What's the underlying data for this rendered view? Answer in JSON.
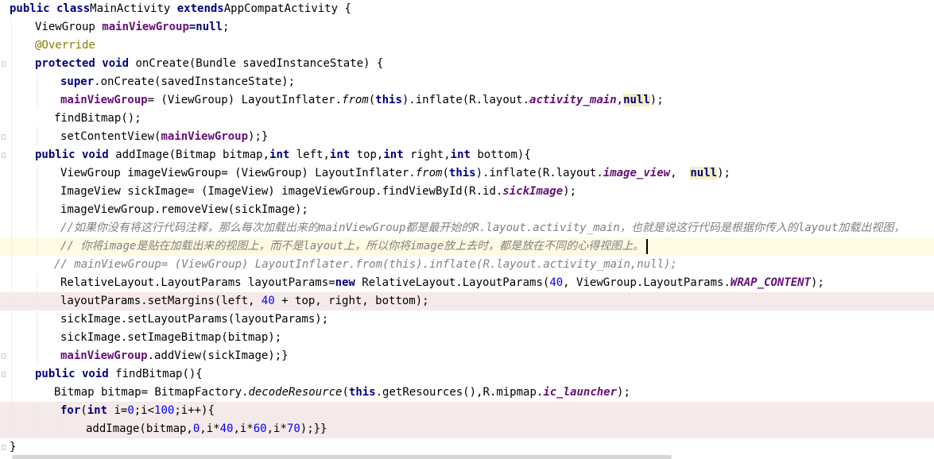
{
  "editor": {
    "language": "Java",
    "lines": [
      {
        "indent": 0,
        "hl": "",
        "tokens": [
          [
            "kw",
            "public class"
          ],
          [
            "",
            "MainActivity "
          ],
          [
            "kw",
            "extends"
          ],
          [
            "",
            "AppCompatActivity {"
          ]
        ]
      },
      {
        "indent": 1,
        "hl": "",
        "tokens": [
          [
            "",
            "ViewGroup "
          ],
          [
            "fld",
            "mainViewGroup"
          ],
          [
            "kw",
            "=null"
          ],
          [
            "",
            ";"
          ]
        ]
      },
      {
        "indent": 1,
        "hl": "",
        "tokens": [
          [
            "ann",
            "@Override"
          ]
        ]
      },
      {
        "indent": 1,
        "hl": "",
        "tokens": [
          [
            "kw",
            "protected void "
          ],
          [
            "",
            "onCreate(Bundle savedInstanceState) {"
          ]
        ]
      },
      {
        "indent": 2,
        "hl": "",
        "tokens": [
          [
            "kw",
            "super"
          ],
          [
            "",
            ".onCreate(savedInstanceState);"
          ]
        ]
      },
      {
        "indent": 2,
        "hl": "",
        "tokens": [
          [
            "fld",
            "mainViewGroup"
          ],
          [
            "",
            "= (ViewGroup) LayoutInflater."
          ],
          [
            "st",
            "from"
          ],
          [
            "",
            "("
          ],
          [
            "kw",
            "this"
          ],
          [
            "",
            ").inflate(R.layout."
          ],
          [
            "fldi",
            "activity_main"
          ],
          [
            "",
            ","
          ],
          [
            "kw nullbox",
            "null"
          ],
          [
            "",
            ");"
          ]
        ]
      },
      {
        "indent": 1.75,
        "hl": "",
        "tokens": [
          [
            "",
            "findBitmap();"
          ]
        ]
      },
      {
        "indent": 2,
        "hl": "",
        "tokens": [
          [
            "",
            "setContentView("
          ],
          [
            "fld",
            "mainViewGroup"
          ],
          [
            "",
            ");}"
          ]
        ]
      },
      {
        "indent": 1,
        "hl": "",
        "tokens": [
          [
            "kw",
            "public void "
          ],
          [
            "",
            "addImage(Bitmap bitmap,"
          ],
          [
            "kw",
            "int "
          ],
          [
            "",
            "left,"
          ],
          [
            "kw",
            "int "
          ],
          [
            "",
            "top,"
          ],
          [
            "kw",
            "int "
          ],
          [
            "",
            "right,"
          ],
          [
            "kw",
            "int "
          ],
          [
            "",
            "bottom){"
          ]
        ]
      },
      {
        "indent": 2,
        "hl": "",
        "tokens": [
          [
            "",
            "ViewGroup imageViewGroup= (ViewGroup) LayoutInflater."
          ],
          [
            "st",
            "from"
          ],
          [
            "",
            "("
          ],
          [
            "kw",
            "this"
          ],
          [
            "",
            ").inflate(R.layout."
          ],
          [
            "fldi",
            "image_view"
          ],
          [
            "",
            ",  "
          ],
          [
            "kw nullbox",
            "null"
          ],
          [
            "",
            ");"
          ]
        ]
      },
      {
        "indent": 2,
        "hl": "",
        "tokens": [
          [
            "",
            "ImageView sickImage= (ImageView) imageViewGroup.findViewById(R.id."
          ],
          [
            "fldi",
            "sickImage"
          ],
          [
            "",
            ");"
          ]
        ]
      },
      {
        "indent": 2,
        "hl": "",
        "tokens": [
          [
            "",
            "imageViewGroup.removeView(sickImage);"
          ]
        ]
      },
      {
        "indent": 2,
        "hl": "",
        "tokens": [
          [
            "cmt",
            "//如果你没有将这行代码注释，那么每次加载出来的mainViewGroup都是最开始的R.layout.activity_main，也就是说这行代码是根据你传入的layout加载出视图，"
          ]
        ]
      },
      {
        "indent": 2,
        "hl": "cur",
        "tokens": [
          [
            "cmt",
            "// 你将image是贴在加载出来的视图上，而不是layout上，所以你将image放上去时，都是放在不同的心得视图上。"
          ]
        ]
      },
      {
        "indent": 1.75,
        "hl": "",
        "tokens": [
          [
            "cmt",
            "// mainViewGroup= (ViewGroup) LayoutInflater.from(this).inflate(R.layout.activity_main,null);"
          ]
        ]
      },
      {
        "indent": 2,
        "hl": "",
        "tokens": [
          [
            "",
            "RelativeLayout.LayoutParams layoutParams="
          ],
          [
            "kw",
            "new "
          ],
          [
            "",
            "RelativeLayout.LayoutParams("
          ],
          [
            "num",
            "40"
          ],
          [
            "",
            ", ViewGroup.LayoutParams."
          ],
          [
            "fldi",
            "WRAP_CONTENT"
          ],
          [
            "",
            ");"
          ]
        ]
      },
      {
        "indent": 2,
        "hl": "hl",
        "tokens": [
          [
            "",
            "layoutParams.setMargins(left, "
          ],
          [
            "num",
            "40"
          ],
          [
            "",
            " + top, right, bottom);"
          ]
        ]
      },
      {
        "indent": 2,
        "hl": "",
        "tokens": [
          [
            "",
            "sickImage.setLayoutParams(layoutParams);"
          ]
        ]
      },
      {
        "indent": 2,
        "hl": "",
        "tokens": [
          [
            "",
            "sickImage.setImageBitmap(bitmap);"
          ]
        ]
      },
      {
        "indent": 2,
        "hl": "",
        "tokens": [
          [
            "fld",
            "mainViewGroup"
          ],
          [
            "",
            ".addView(sickImage);}"
          ]
        ]
      },
      {
        "indent": 1,
        "hl": "",
        "tokens": [
          [
            "kw",
            "public void "
          ],
          [
            "",
            "findBitmap(){"
          ]
        ]
      },
      {
        "indent": 1.75,
        "hl": "",
        "tokens": [
          [
            "",
            "Bitmap bitmap= BitmapFactory."
          ],
          [
            "st",
            "decodeResource"
          ],
          [
            "",
            "("
          ],
          [
            "kw",
            "this"
          ],
          [
            "",
            ".getResources(),R.mipmap."
          ],
          [
            "fldi",
            "ic_launcher"
          ],
          [
            "",
            ");"
          ]
        ]
      },
      {
        "indent": 2,
        "hl": "hl",
        "tokens": [
          [
            "kw",
            "for"
          ],
          [
            "",
            "("
          ],
          [
            "kw",
            "int "
          ],
          [
            "",
            "i="
          ],
          [
            "num",
            "0"
          ],
          [
            "",
            ";i<"
          ],
          [
            "num",
            "100"
          ],
          [
            "",
            ";i++){"
          ]
        ]
      },
      {
        "indent": 3,
        "hl": "hl",
        "tokens": [
          [
            "",
            "addImage(bitmap,"
          ],
          [
            "num",
            "0"
          ],
          [
            "",
            ",i*"
          ],
          [
            "num",
            "40"
          ],
          [
            "",
            ",i*"
          ],
          [
            "num",
            "60"
          ],
          [
            "",
            ",i*"
          ],
          [
            "num",
            "70"
          ],
          [
            "",
            ");}}"
          ]
        ]
      },
      {
        "indent": 0,
        "hl": "",
        "tokens": [
          [
            "",
            "}"
          ]
        ]
      }
    ]
  }
}
